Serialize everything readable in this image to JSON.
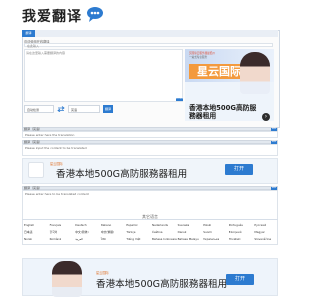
{
  "header": {
    "logo_text": "我爱翻译"
  },
  "translator": {
    "active_tab": "翻译",
    "top_label": "欢迎使用在线翻译",
    "top_placeholder": "在此输入",
    "source_placeholder": "请在这里输入需要翻译的内容",
    "counter": "0/1000",
    "from_lang": "自动检测",
    "swap_icon": "swap-icon",
    "to_lang": "英语",
    "translate_button": "翻译"
  },
  "side_ad": {
    "small_line1": "买国际云服务器最低价",
    "small_line2": "一站式专业服务",
    "brand": "星云国际",
    "headline": "香港本地500G高防服務器租用",
    "arrow": "›"
  },
  "results": [
    {
      "label": "翻译（英语）",
      "placeholder": "Please enter here the translation",
      "btn": "复制"
    },
    {
      "label": "翻译（英语）",
      "placeholder": "Please input the content to be translated",
      "btn": "复制"
    },
    {
      "label": "翻译（英语）",
      "placeholder": "Please enter here to be translated content",
      "btn": "复制"
    }
  ],
  "banner": {
    "logo": "星云国际",
    "title": "香港本地500G高防服務器租用",
    "button": "打开"
  },
  "languages_section": {
    "title": "其它语言",
    "items": [
      "English",
      "Français",
      "Deutsch",
      "Italiano",
      "Español",
      "Nederlands",
      "Svenska",
      "Polski",
      "Português",
      "Русский",
      "日本語",
      "한국어",
      "中文(简体)",
      "中文(繁體)",
      "Türkçe",
      "Čeština",
      "Dansk",
      "Suomi",
      "Ελληνικά",
      "Magyar",
      "Norsk",
      "Română",
      "العربية",
      "ไทย",
      "Tiếng Việt",
      "Bahasa Indonesia",
      "Bahasa Melayu",
      "Українська",
      "Hrvatski",
      "Slovenščina"
    ]
  },
  "footer_ad": {
    "logo": "星云国际",
    "title": "香港本地500G高防服務器租用",
    "button": "打开"
  }
}
